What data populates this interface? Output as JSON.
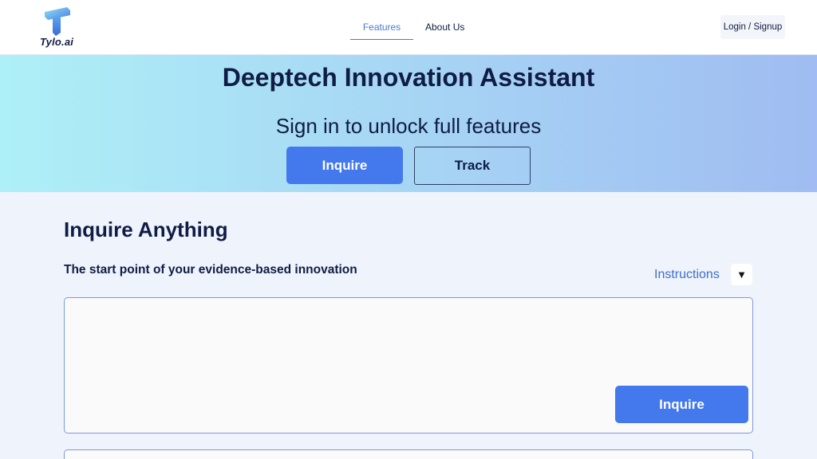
{
  "brand": {
    "name": "Tylo.ai",
    "logo_icon": "t-logo-icon",
    "accent": "#4379ec"
  },
  "nav": {
    "items": [
      {
        "label": "Features",
        "active": true
      },
      {
        "label": "About Us",
        "active": false
      }
    ]
  },
  "header": {
    "login_label": "Login / Signup"
  },
  "hero": {
    "title": "Deeptech Innovation Assistant",
    "subtitle": "Sign in to unlock full features",
    "inquire_label": "Inquire",
    "track_label": "Track"
  },
  "main": {
    "title": "Inquire Anything",
    "subtitle": "The start point of your evidence-based innovation",
    "instructions_label": "Instructions",
    "toggle_icon": "▼",
    "input_value": "",
    "input_placeholder": "",
    "inquire_label": "Inquire"
  }
}
